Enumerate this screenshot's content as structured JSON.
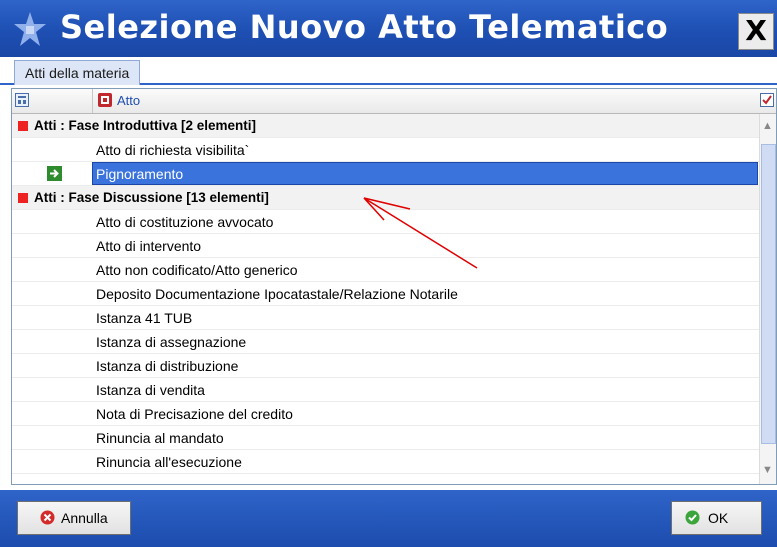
{
  "window": {
    "title": "Selezione Nuovo Atto Telematico",
    "close_label": "X"
  },
  "tabs": [
    {
      "label": "Atti della materia",
      "selected": true
    }
  ],
  "grid": {
    "columns": [
      {
        "label": "Atto"
      }
    ],
    "rows": [
      {
        "type": "group",
        "label": "Atti : Fase Introduttiva  [2 elementi]"
      },
      {
        "type": "item",
        "label": "Atto di richiesta visibilita`"
      },
      {
        "type": "item",
        "label": "Pignoramento",
        "selected": true
      },
      {
        "type": "group",
        "label": "Atti : Fase Discussione  [13 elementi]"
      },
      {
        "type": "item",
        "label": "Atto di costituzione avvocato"
      },
      {
        "type": "item",
        "label": "Atto di intervento"
      },
      {
        "type": "item",
        "label": "Atto non codificato/Atto generico"
      },
      {
        "type": "item",
        "label": "Deposito Documentazione Ipocatastale/Relazione Notarile"
      },
      {
        "type": "item",
        "label": "Istanza 41 TUB"
      },
      {
        "type": "item",
        "label": "Istanza di assegnazione"
      },
      {
        "type": "item",
        "label": "Istanza di distribuzione"
      },
      {
        "type": "item",
        "label": "Istanza di vendita"
      },
      {
        "type": "item",
        "label": "Nota di Precisazione del credito"
      },
      {
        "type": "item",
        "label": "Rinuncia al mandato"
      },
      {
        "type": "item",
        "label": "Rinuncia all'esecuzione"
      }
    ]
  },
  "footer": {
    "cancel_label": "Annulla",
    "ok_label": "OK"
  },
  "colors": {
    "titlebar": "#1e4fb3",
    "selection": "#3b73dd",
    "group_marker": "#e22222",
    "annotation_arrow": "#e00000"
  }
}
